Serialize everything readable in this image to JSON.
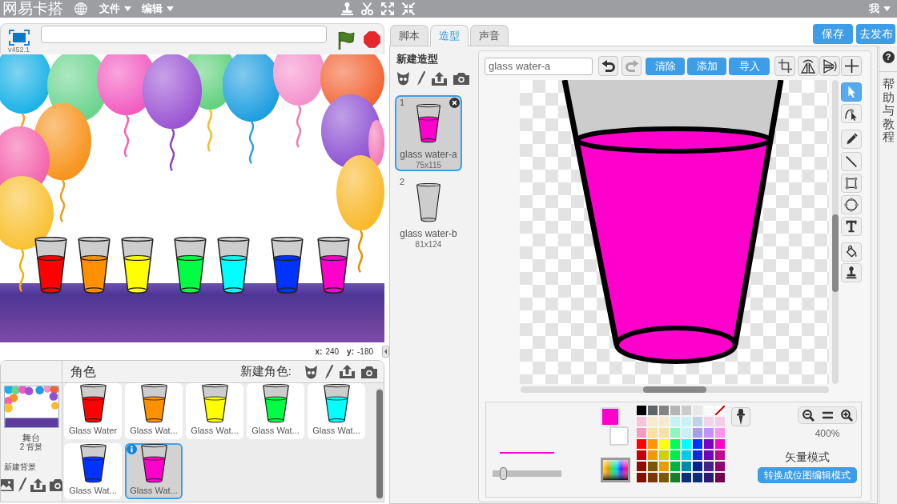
{
  "menu_bar": {
    "logo": "网易卡搭",
    "menus": [
      "文件",
      "编辑"
    ],
    "user_menu": "我"
  },
  "stage_header": {
    "version": "v452.1"
  },
  "stage": {
    "coordinates": [
      {
        "label": "x:",
        "value": "240"
      },
      {
        "label": "y:",
        "value": "-180"
      }
    ]
  },
  "sprites_pane": {
    "title": "角色",
    "new_sprite_label": "新建角色:",
    "stage_item": {
      "name": "舞台",
      "backdrop_count": "2 背景"
    },
    "new_backdrop_label": "新建背景",
    "sprites": [
      {
        "name": "Glass Water",
        "color": "#ff0000",
        "selected": false
      },
      {
        "name": "Glass Wat...",
        "color": "#ff9000",
        "selected": false
      },
      {
        "name": "Glass Wat...",
        "color": "#ffff00",
        "selected": false
      },
      {
        "name": "Glass Wat...",
        "color": "#00ff44",
        "selected": false
      },
      {
        "name": "Glass Wat...",
        "color": "#00ffff",
        "selected": false
      },
      {
        "name": "Glass Wat...",
        "color": "#0033ff",
        "selected": false
      },
      {
        "name": "Glass Wat...",
        "color": "#ff00cc",
        "selected": true
      }
    ]
  },
  "tabs": [
    {
      "label": "脚本",
      "selected": false
    },
    {
      "label": "造型",
      "selected": true
    },
    {
      "label": "声音",
      "selected": false
    }
  ],
  "top_buttons": [
    "保存",
    "去发布"
  ],
  "costumes": {
    "new_costume_label": "新建造型",
    "items": [
      {
        "number": "1",
        "name": "glass water-a",
        "size": "75x115",
        "color": "#ff00cc",
        "selected": true
      },
      {
        "number": "2",
        "name": "glass water-b",
        "size": "81x124",
        "selected": false
      }
    ]
  },
  "paint_editor": {
    "costume_name": "glass water-a",
    "history": [
      {
        "kind": "undo",
        "disabled": false
      },
      {
        "kind": "redo",
        "disabled": true
      }
    ],
    "actions": [
      "清除",
      "添加",
      "导入"
    ],
    "tools": [
      {
        "kind": "select",
        "selected": true
      },
      {
        "kind": "reshape",
        "selected": false
      },
      {
        "kind": "pencil",
        "selected": false
      },
      {
        "kind": "line",
        "selected": false
      },
      {
        "kind": "rectangle",
        "selected": false
      },
      {
        "kind": "ellipse",
        "selected": false
      },
      {
        "kind": "text",
        "selected": false
      },
      {
        "kind": "fill",
        "selected": false
      },
      {
        "kind": "stamp",
        "selected": false
      }
    ],
    "line_width": {
      "level": 0.12
    },
    "fill_swatch": {
      "color": "#ff00cc"
    },
    "background_swatch": {
      "color": "#ffffff"
    },
    "palette": [
      {
        "kind": "solid",
        "color": "#000000"
      },
      {
        "kind": "solid",
        "color": "#5f6468"
      },
      {
        "kind": "solid",
        "color": "#848484"
      },
      {
        "kind": "solid",
        "color": "#b4b4b4"
      },
      {
        "kind": "solid",
        "color": "#cbcbcb"
      },
      {
        "kind": "solid",
        "color": "#e8e8e8"
      },
      {
        "kind": "solid",
        "color": "#ffffff"
      },
      {
        "kind": "none"
      },
      {
        "kind": "solid",
        "color": "#f8c4dc"
      },
      {
        "kind": "solid",
        "color": "#f9ebd0"
      },
      {
        "kind": "solid",
        "color": "#f8ebcd"
      },
      {
        "kind": "solid",
        "color": "#c6f4f6"
      },
      {
        "kind": "solid",
        "color": "#c8f2f6"
      },
      {
        "kind": "solid",
        "color": "#c0d2e6"
      },
      {
        "kind": "solid",
        "color": "#f0d4ee"
      },
      {
        "kind": "solid",
        "color": "#f8cce8"
      },
      {
        "kind": "solid",
        "color": "#f49cc6"
      },
      {
        "kind": "solid",
        "color": "#f9e29e"
      },
      {
        "kind": "solid",
        "color": "#f8e09e"
      },
      {
        "kind": "solid",
        "color": "#8cf8c0"
      },
      {
        "kind": "solid",
        "color": "#c8f0f6"
      },
      {
        "kind": "solid",
        "color": "#a89ee6"
      },
      {
        "kind": "solid",
        "color": "#c292f6"
      },
      {
        "kind": "solid",
        "color": "#fc94e8"
      },
      {
        "kind": "solid",
        "color": "#ff0000"
      },
      {
        "kind": "solid",
        "color": "#ff9600"
      },
      {
        "kind": "solid",
        "color": "#ffff00"
      },
      {
        "kind": "solid",
        "color": "#00ff55"
      },
      {
        "kind": "solid",
        "color": "#00ffff"
      },
      {
        "kind": "solid",
        "color": "#0033ff"
      },
      {
        "kind": "solid",
        "color": "#7b00c2"
      },
      {
        "kind": "solid",
        "color": "#ff00cc"
      },
      {
        "kind": "solid",
        "color": "#c20000"
      },
      {
        "kind": "solid",
        "color": "#ec9b00"
      },
      {
        "kind": "solid",
        "color": "#d0cd14"
      },
      {
        "kind": "solid",
        "color": "#00ee44"
      },
      {
        "kind": "solid",
        "color": "#00cbea"
      },
      {
        "kind": "solid",
        "color": "#0031db"
      },
      {
        "kind": "solid",
        "color": "#7500b9"
      },
      {
        "kind": "solid",
        "color": "#c80090"
      },
      {
        "kind": "solid",
        "color": "#8a0f00"
      },
      {
        "kind": "solid",
        "color": "#7b5600"
      },
      {
        "kind": "solid",
        "color": "#ec9b00"
      },
      {
        "kind": "solid",
        "color": "#00b43c"
      },
      {
        "kind": "solid",
        "color": "#0089a6"
      },
      {
        "kind": "solid",
        "color": "#002494"
      },
      {
        "kind": "solid",
        "color": "#46238c"
      },
      {
        "kind": "solid",
        "color": "#940072"
      },
      {
        "kind": "solid",
        "color": "#850d00"
      },
      {
        "kind": "solid",
        "color": "#7d3600"
      },
      {
        "kind": "solid",
        "color": "#7a5800"
      },
      {
        "kind": "solid",
        "color": "#177d26"
      },
      {
        "kind": "solid",
        "color": "#0b2e79"
      },
      {
        "kind": "solid",
        "color": "#0b2e79"
      },
      {
        "kind": "solid",
        "color": "#2a1b70"
      },
      {
        "kind": "solid",
        "color": "#74004d"
      }
    ],
    "zoom": "400%",
    "mode": "矢量模式",
    "convert_button": "转换成位图编辑模式"
  },
  "help": {
    "icon": "?",
    "label": "帮助与教程"
  }
}
